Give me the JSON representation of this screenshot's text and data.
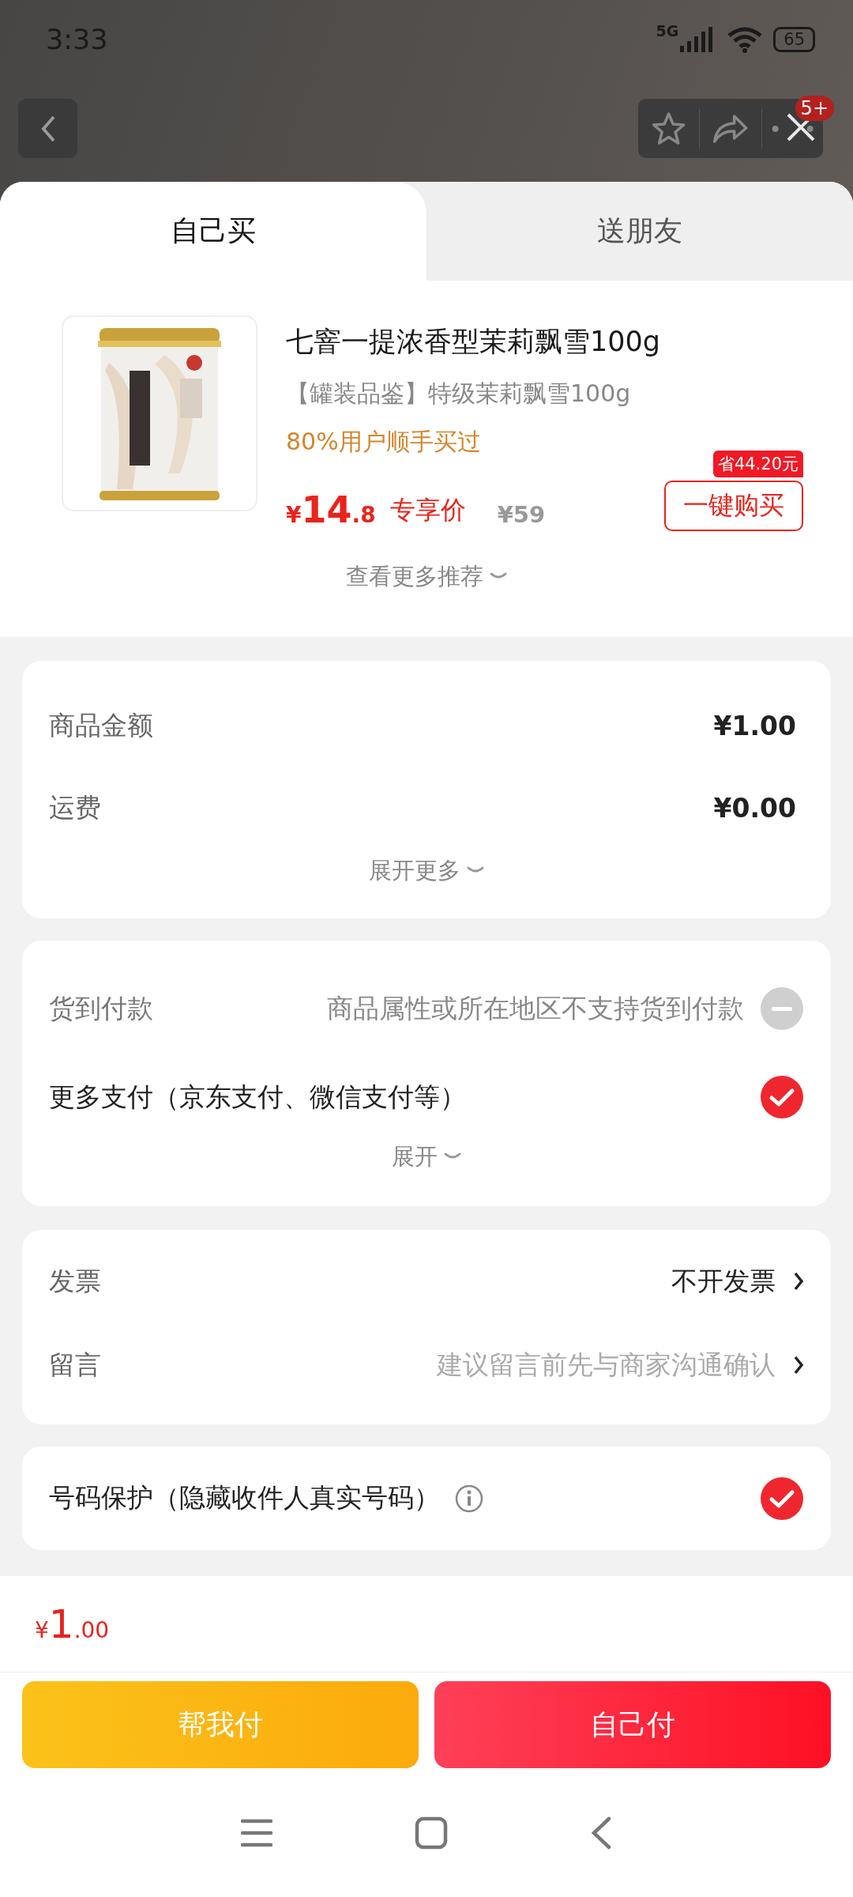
{
  "status_bar": {
    "time": "3:33",
    "network": "5G",
    "battery": "65"
  },
  "header": {
    "badge": "5+"
  },
  "tabs": [
    {
      "label": "自己买",
      "selected": true
    },
    {
      "label": "送朋友",
      "selected": false
    }
  ],
  "recommendation": {
    "kind": "picture",
    "title": "七窨一提浓香型茉莉飘雪100g",
    "subtitle": "【罐装品鉴】特级茉莉飘雪100g",
    "social_proof": "80%用户顺手买过",
    "price_symbol": "¥",
    "price_int": "14",
    "price_dec": ".8",
    "price_label": "专享价",
    "original_price": "¥59",
    "savings_badge": "省44.20元",
    "buy_button": "一键购买",
    "more": "查看更多推荐"
  },
  "costs": {
    "rows": [
      {
        "label": "商品金额",
        "value": "¥1.00"
      },
      {
        "label": "运费",
        "value": "¥0.00"
      }
    ],
    "expand": "展开更多"
  },
  "payment": {
    "options": [
      {
        "label": "货到付款",
        "note": "商品属性或所在地区不支持货到付款",
        "checked": false,
        "disabled": true
      },
      {
        "label": "更多支付（京东支付、微信支付等）",
        "checked": true,
        "disabled": false
      }
    ],
    "expand": "展开"
  },
  "details": [
    {
      "label": "发票",
      "value": "不开发票"
    },
    {
      "label": "留言",
      "placeholder": "建议留言前先与商家沟通确认"
    }
  ],
  "privacy": {
    "label": "号码保护（隐藏收件人真实号码）",
    "checked": true
  },
  "footer": {
    "total_symbol": "¥",
    "total_int": "1",
    "total_dec": ".00",
    "buttons": [
      {
        "label": "帮我付",
        "kind": "secondary"
      },
      {
        "label": "自己付",
        "kind": "primary"
      }
    ]
  }
}
